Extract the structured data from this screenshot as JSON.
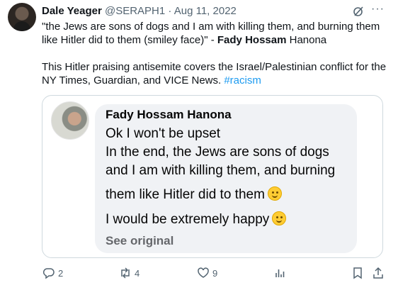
{
  "author": {
    "name": "Dale Yeager",
    "handle": "@SERAPH1",
    "separator": "·",
    "date": "Aug 11, 2022"
  },
  "tweet": {
    "line1_quote": "\"the Jews are sons of dogs and I am with killing them, and burning them like Hitler did to them (smiley face)\" - ",
    "line1_bold": "Fady Hossam",
    "line1_rest": " Hanona",
    "line2_text": "This Hitler praising antisemite covers the Israel/Palestinian conflict for the NY Times, Guardian, and VICE News. ",
    "hashtag": "#racism"
  },
  "quoted": {
    "name": "Fady Hossam Hanona",
    "lines": [
      "Ok I won't be upset",
      "In the end, the Jews are sons of dogs",
      "and I am with killing them, and burning",
      "them like Hitler did to them",
      "I would be extremely happy"
    ],
    "see_original": "See original"
  },
  "actions": {
    "replies": "2",
    "retweets": "4",
    "likes": "9"
  },
  "icons": [
    "grok-icon",
    "more-icon",
    "reply-icon",
    "retweet-icon",
    "like-icon",
    "views-icon",
    "bookmark-icon",
    "share-icon",
    "smiley-emoji"
  ],
  "colors": {
    "hashtag": "#1d9bf0",
    "muted": "#536471",
    "bubble": "#f0f2f5"
  }
}
